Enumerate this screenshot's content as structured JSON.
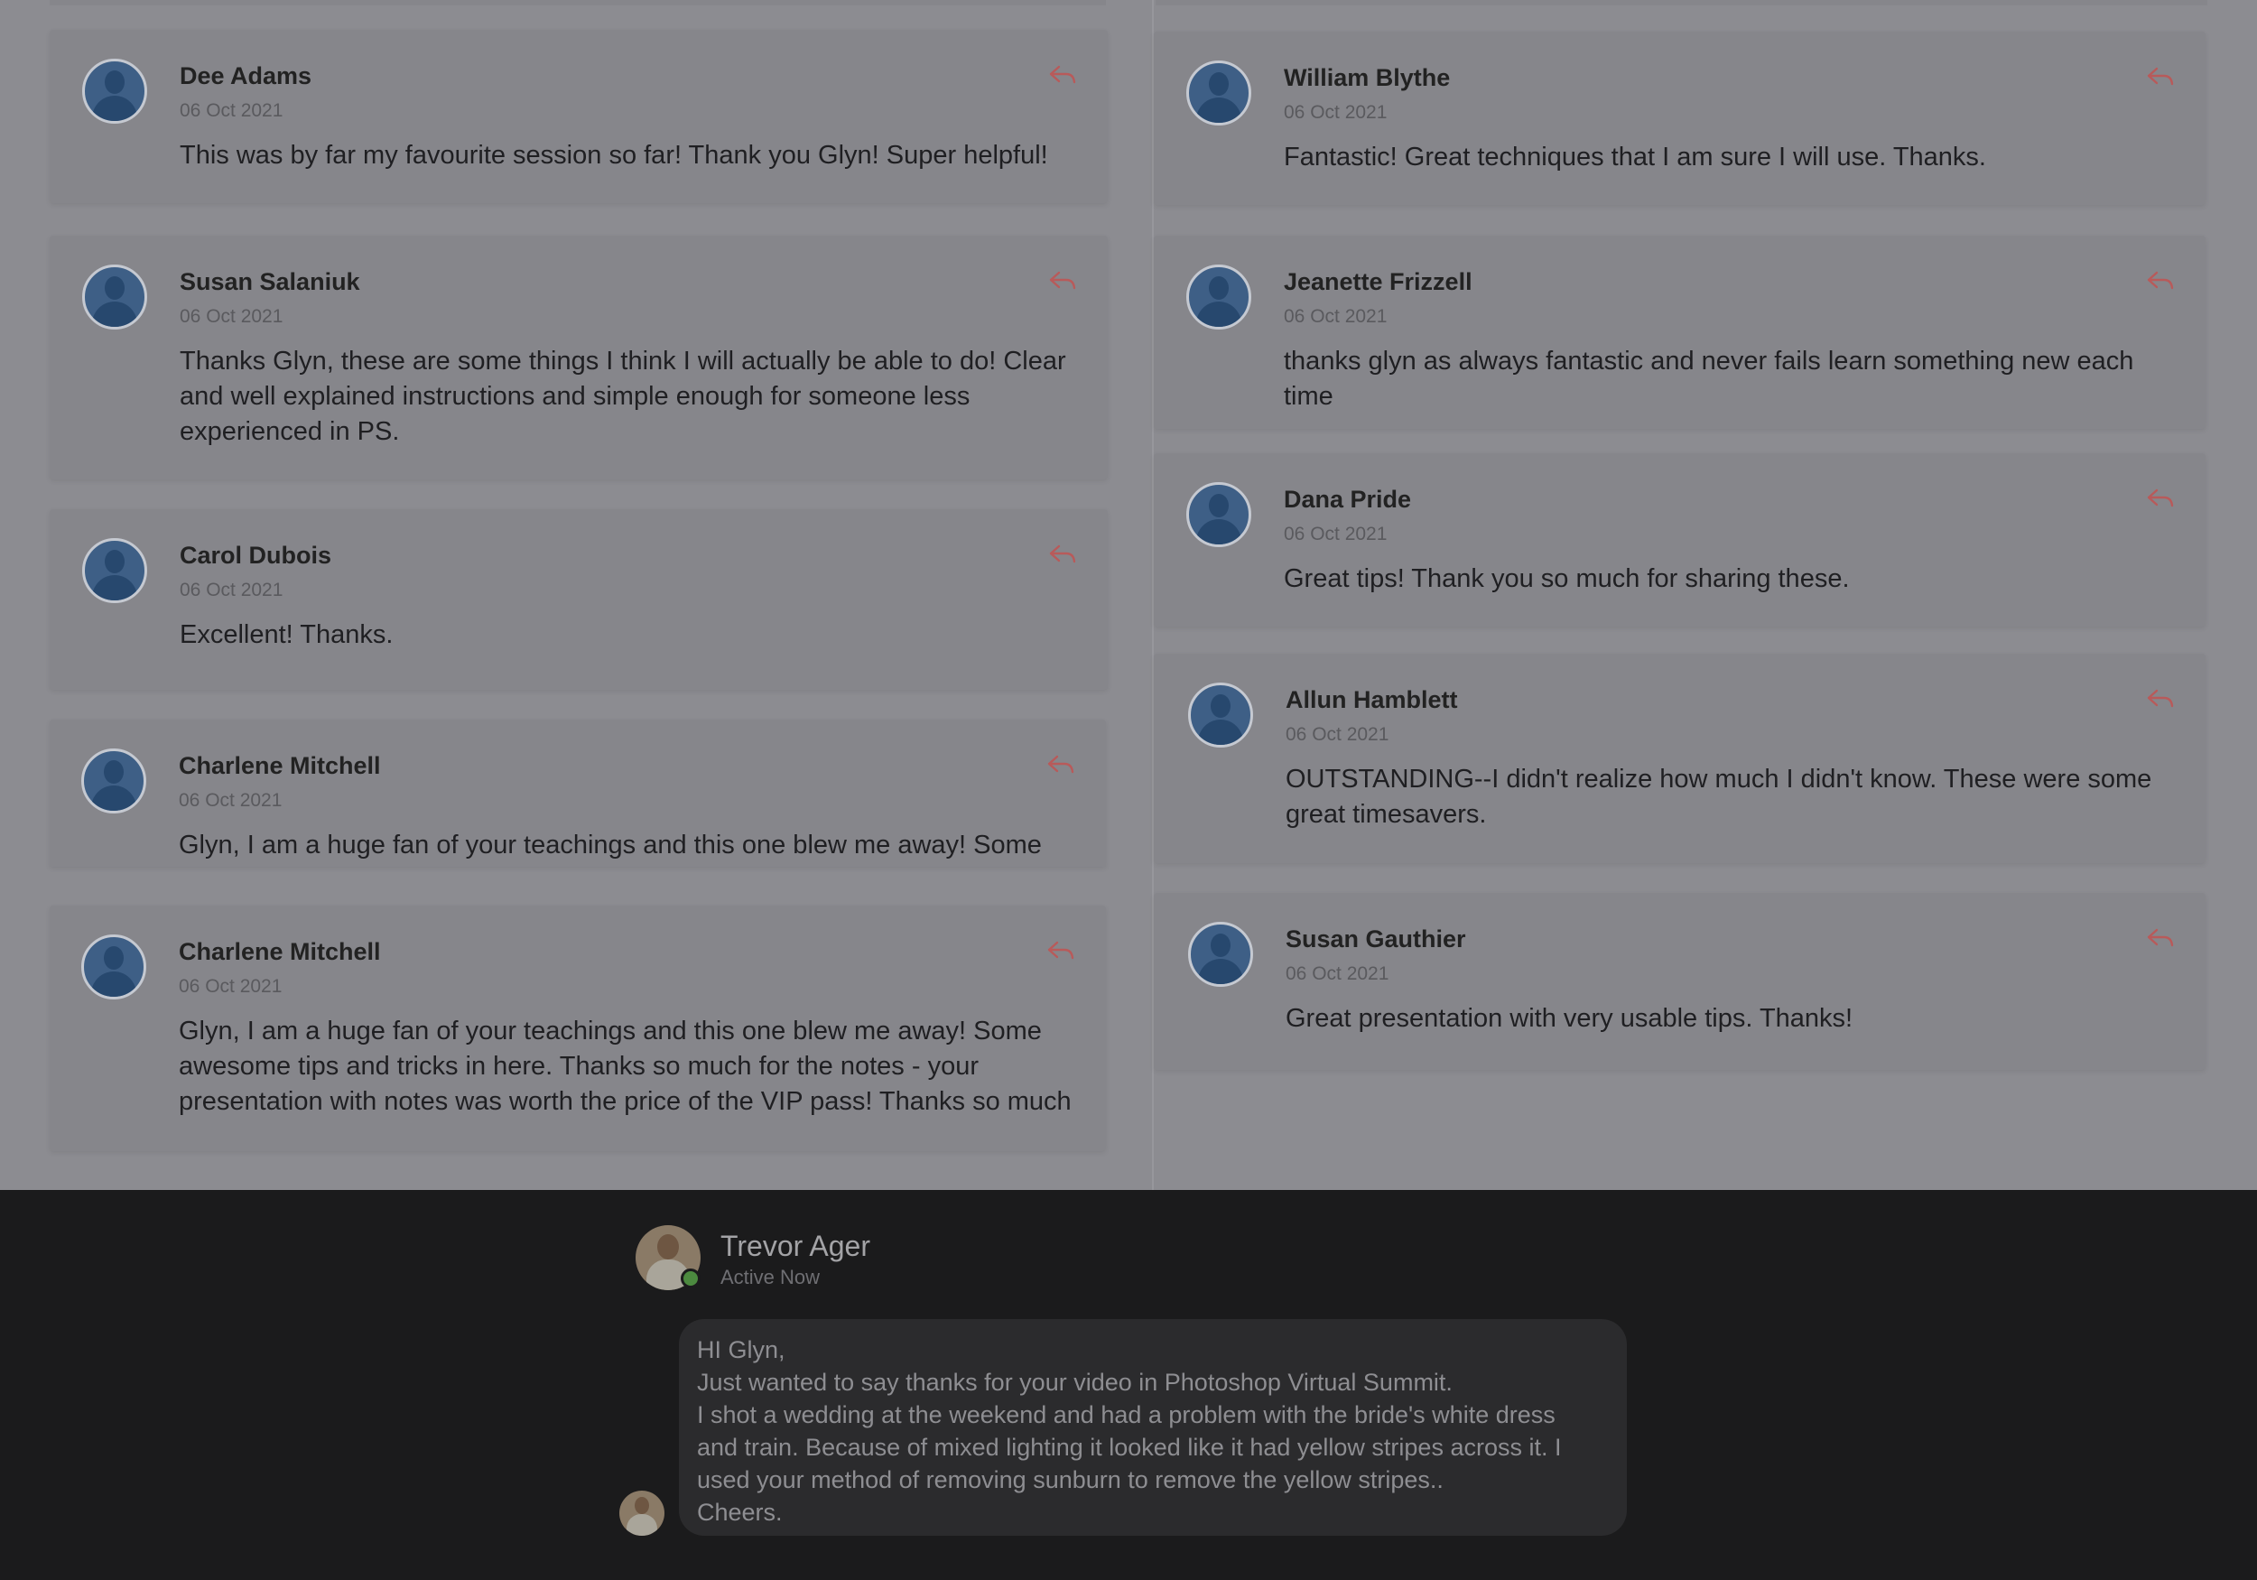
{
  "comments_left": [
    {
      "name": "Dee Adams",
      "date": "06 Oct 2021",
      "text": "This was by far my favourite session so far! Thank you Glyn! Super helpful!"
    },
    {
      "name": "Susan Salaniuk",
      "date": "06 Oct 2021",
      "text": "Thanks Glyn, these are some things I think I will actually be able to do! Clear and well explained instructions and simple enough for someone less experienced in PS."
    },
    {
      "name": "Carol Dubois",
      "date": "06 Oct 2021",
      "text": "Excellent! Thanks."
    },
    {
      "name": "Charlene Mitchell",
      "date": "06 Oct 2021",
      "text": "Glyn, I am a huge fan of your teachings and this one blew me away! Some"
    },
    {
      "name": "Charlene Mitchell",
      "date": "06 Oct 2021",
      "text": "Glyn, I am a huge fan of your teachings and this one blew me away! Some awesome tips and tricks in here. Thanks so much for the notes - your presentation with notes was worth the price of the VIP pass! Thanks so much"
    }
  ],
  "comments_right": [
    {
      "name": "William Blythe",
      "date": "06 Oct 2021",
      "text": "Fantastic! Great techniques that I am sure I will use. Thanks."
    },
    {
      "name": "Jeanette Frizzell",
      "date": "06 Oct 2021",
      "text": "thanks glyn as always fantastic and never fails learn something new each time"
    },
    {
      "name": "Dana Pride",
      "date": "06 Oct 2021",
      "text": "Great tips! Thank you so much for sharing these."
    },
    {
      "name": "Allun Hamblett",
      "date": "06 Oct 2021",
      "text": "OUTSTANDING--I didn't realize how much I didn't know. These were some great timesavers."
    },
    {
      "name": "Susan Gauthier",
      "date": "06 Oct 2021",
      "text": "Great presentation with very usable tips. Thanks!"
    }
  ],
  "icons": {
    "avatar": "user-silhouette-icon",
    "reply": "reply-arrow-icon",
    "online": "online-status-dot"
  },
  "colors": {
    "avatar_bg": "#3e5f86",
    "reply_icon": "#b85a5a",
    "online_dot": "#4c8a3f"
  },
  "chat": {
    "sender_name": "Trevor Ager",
    "status": "Active Now",
    "message_lines": [
      "HI Glyn,",
      "Just wanted to say thanks for your video in Photoshop Virtual Summit.",
      "I shot a wedding at the weekend and had a problem with the bride's white dress",
      "and train. Because of mixed lighting it looked like it had yellow stripes across it. I",
      "used your method of removing sunburn to remove the yellow stripes..",
      "Cheers."
    ]
  }
}
